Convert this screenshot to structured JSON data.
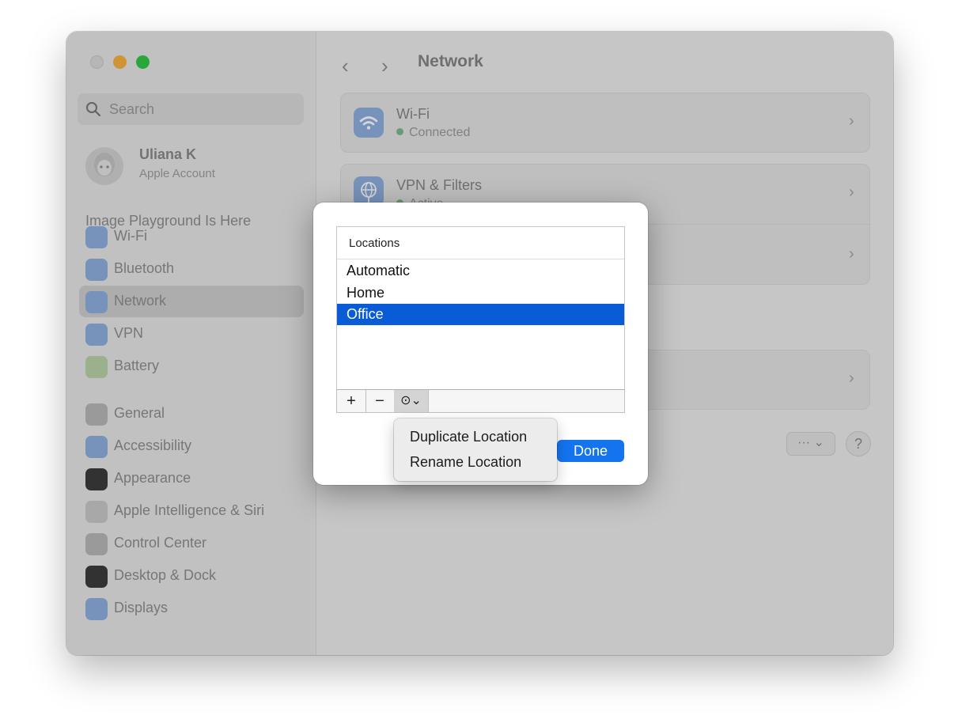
{
  "sidebar": {
    "search_placeholder": "Search",
    "account": {
      "name": "Uliana K",
      "subtitle": "Apple Account"
    },
    "promo": "Image Playground Is Here",
    "items": [
      {
        "label": "Wi-Fi",
        "icon": "wifi-icon",
        "color": "#8eb0e0"
      },
      {
        "label": "Bluetooth",
        "icon": "bluetooth-icon",
        "color": "#8eb0e0"
      },
      {
        "label": "Network",
        "icon": "globe-icon",
        "color": "#8eb0e0",
        "selected": true
      },
      {
        "label": "VPN",
        "icon": "vpn-globe-icon",
        "color": "#8eb0e0"
      },
      {
        "label": "Battery",
        "icon": "battery-icon",
        "color": "#b9d2a8"
      },
      {
        "label": "General",
        "icon": "gear-icon",
        "color": "#b8b8b8"
      },
      {
        "label": "Accessibility",
        "icon": "accessibility-icon",
        "color": "#8eb0e0"
      },
      {
        "label": "Appearance",
        "icon": "appearance-icon",
        "color": "#3c3c3c"
      },
      {
        "label": "Apple Intelligence & Siri",
        "icon": "siri-icon",
        "color": "#c9c9c9"
      },
      {
        "label": "Control Center",
        "icon": "control-center-icon",
        "color": "#b8b8b8"
      },
      {
        "label": "Desktop & Dock",
        "icon": "dock-icon",
        "color": "#3c3c3c"
      },
      {
        "label": "Displays",
        "icon": "displays-icon",
        "color": "#8eb0e0"
      }
    ]
  },
  "header": {
    "title": "Network",
    "back": "‹",
    "forward": "›"
  },
  "network": {
    "wifi": {
      "title": "Wi-Fi",
      "status": "Connected"
    },
    "vpn": {
      "title": "VPN & Filters",
      "status": "Active"
    }
  },
  "footer": {
    "more": "··· ⌄",
    "help": "?"
  },
  "dialog": {
    "header": "Locations",
    "locations": [
      {
        "name": "Automatic",
        "selected": false
      },
      {
        "name": "Home",
        "selected": false
      },
      {
        "name": "Office",
        "selected": true
      }
    ],
    "toolbar": {
      "add": "+",
      "remove": "−",
      "actions": "⊙⌄"
    },
    "done": "Done"
  },
  "menu": {
    "items": [
      "Duplicate Location",
      "Rename Location"
    ]
  },
  "colors": {
    "accent": "#1474ef",
    "selection": "#0a5cd6",
    "close": "#d9d9d9",
    "minimize": "#f6b23e",
    "zoom": "#33c748"
  }
}
